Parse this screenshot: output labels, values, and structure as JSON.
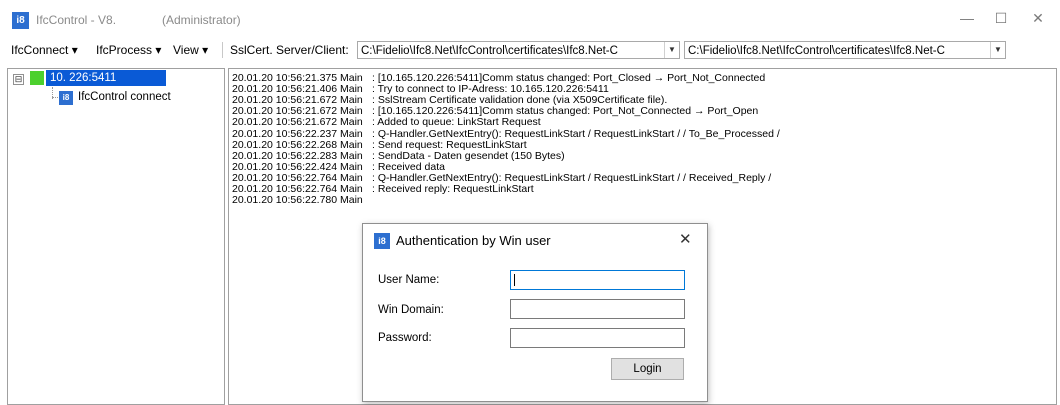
{
  "window": {
    "title": "IfcControl - V8.",
    "admin": "(Administrator)",
    "icon": "ifc8-app-icon"
  },
  "menu": {
    "items": [
      "IfcConnect ▾",
      "IfcProcess ▾",
      "View ▾",
      "SslCert. Server/Client:"
    ],
    "server_cert": "C:\\Fidelio\\Ifc8.Net\\IfcControl\\certificates\\Ifc8.Net-C",
    "client_cert": "C:\\Fidelio\\Ifc8.Net\\IfcControl\\certificates\\Ifc8.Net-C"
  },
  "tree": {
    "expander": "⊟",
    "root_label": "10.          226:5411",
    "child_label": "IfcControl connect"
  },
  "log": [
    {
      "ts": "20.01.20 10:56:21.375 Main",
      "msg": ": [10.165.120.226:5411]Comm status changed: Port_Closed → Port_Not_Connected"
    },
    {
      "ts": "20.01.20 10:56:21.406 Main",
      "msg": ": Try to connect to IP-Adress: 10.165.120.226:5411"
    },
    {
      "ts": "20.01.20 10:56:21.672 Main",
      "msg": ": SslStream Certificate validation done (via X509Certificate file)."
    },
    {
      "ts": "20.01.20 10:56:21.672 Main",
      "msg": ": [10.165.120.226:5411]Comm status changed: Port_Not_Connected → Port_Open"
    },
    {
      "ts": "20.01.20 10:56:21.672 Main",
      "msg": ": Added to queue: LinkStart Request"
    },
    {
      "ts": "20.01.20 10:56:22.237 Main",
      "msg": ": Q-Handler.GetNextEntry(): RequestLinkStart / RequestLinkStart / / To_Be_Processed /"
    },
    {
      "ts": "20.01.20 10:56:22.268 Main",
      "msg": ": Send request: RequestLinkStart"
    },
    {
      "ts": "20.01.20 10:56:22.283 Main",
      "msg": ": SendData - Daten gesendet (150 Bytes)"
    },
    {
      "ts": "20.01.20 10:56:22.424 Main",
      "msg": ": Received data"
    },
    {
      "ts": "20.01.20 10:56:22.764 Main",
      "msg": ": Q-Handler.GetNextEntry(): RequestLinkStart / RequestLinkStart / / Received_Reply /"
    },
    {
      "ts": "20.01.20 10:56:22.764 Main",
      "msg": ": Received reply: RequestLinkStart"
    },
    {
      "ts": "20.01.20 10:56:22.780 Main",
      "msg": ""
    }
  ],
  "dialog": {
    "title": "Authentication by Win user",
    "close": "✕",
    "user_label": "User Name:",
    "domain_label": "Win Domain:",
    "password_label": "Password:",
    "user_value": "",
    "domain_value": "",
    "password_value": "",
    "login_label": "Login"
  }
}
